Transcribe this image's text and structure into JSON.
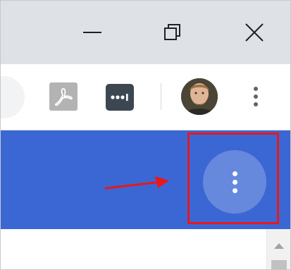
{
  "window_controls": {
    "minimize_icon": "minimize-icon",
    "restore_icon": "restore-icon",
    "close_icon": "close-icon"
  },
  "toolbar": {
    "extensions": [
      {
        "icon": "adobe-pdf-icon"
      },
      {
        "icon": "password-manager-icon"
      }
    ],
    "profile_icon": "avatar",
    "menu_icon": "more-vert-icon"
  },
  "app_bar": {
    "color": "#3b67d4",
    "menu_icon": "more-vert-icon"
  },
  "annotation": {
    "box_color": "#e8181b",
    "arrow_color": "#e8181b"
  },
  "scrollbar": {
    "up_icon": "scroll-up-arrow-icon"
  }
}
